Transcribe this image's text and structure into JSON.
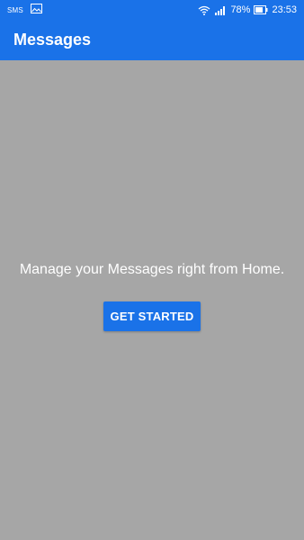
{
  "status_bar": {
    "sms_label": "SMS",
    "battery_percent": "78%",
    "time": "23:53",
    "icons": [
      "sms-icon",
      "image-icon",
      "wifi-icon",
      "signal-icon",
      "battery-icon"
    ]
  },
  "app_bar": {
    "title": "Messages"
  },
  "main": {
    "message": "Manage your Messages right from Home.",
    "get_started_label": "GET STARTED"
  },
  "colors": {
    "accent": "#1a72e8",
    "background": "#a6a6a6",
    "text": "#ffffff"
  }
}
